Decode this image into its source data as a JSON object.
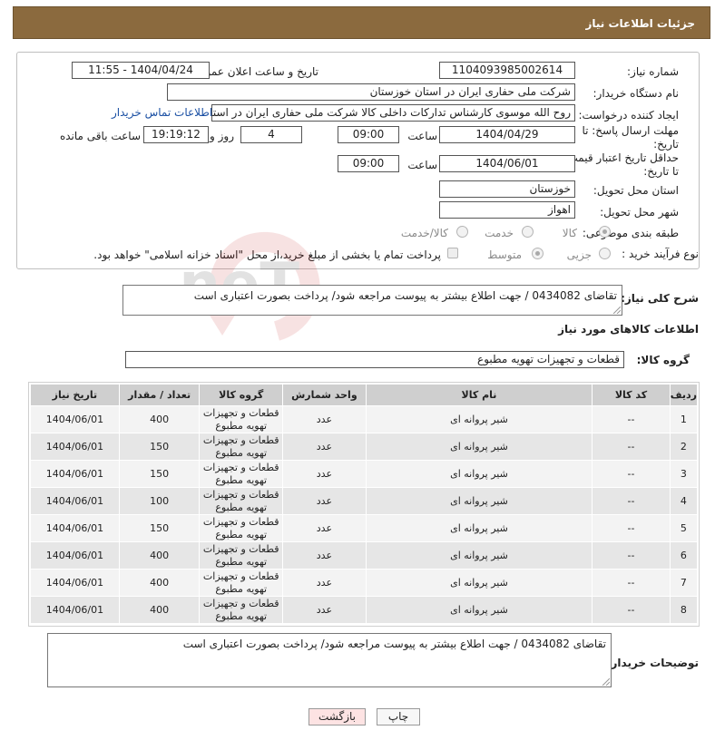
{
  "header": {
    "title": "جزئیات اطلاعات نیاز"
  },
  "form": {
    "need_number_label": "شماره نیاز:",
    "need_number": "1104093985002614",
    "announce_label": "تاریخ و ساعت اعلان عمومی:",
    "announce_value": "1404/04/24 - 11:55",
    "buyer_org_label": "نام دستگاه خریدار:",
    "buyer_org": "شرکت ملی حفاری ایران در استان خوزستان",
    "creator_label": "ایجاد کننده درخواست:",
    "creator": "روح الله موسوی کارشناس تدارکات داخلی کالا شرکت ملی حفاری ایران در استان خوزستان",
    "contact_link": "اطلاعات تماس خریدار",
    "reply_deadline_label_1": "مهلت ارسال پاسخ: تا",
    "reply_deadline_label_2": "تاریخ:",
    "reply_date": "1404/04/29",
    "time_label": "ساعت",
    "reply_time": "09:00",
    "days_value": "4",
    "days_label": "روز و",
    "remaining_time": "19:19:12",
    "remaining_label": "ساعت باقی مانده",
    "price_deadline_label_1": "حداقل تاریخ اعتبار قیمت:",
    "price_deadline_label_2": "تا تاریخ:",
    "price_date": "1404/06/01",
    "price_time": "09:00",
    "province_label": "استان محل تحویل:",
    "province": "خوزستان",
    "city_label": "شهر محل تحویل:",
    "city": "اهواز",
    "category_label": "طبقه بندی موضوعی:",
    "category_options": [
      "کالا",
      "خدمت",
      "کالا/خدمت"
    ],
    "process_label": "نوع فرآیند خرید :",
    "process_options": [
      "جزیی",
      "متوسط"
    ],
    "payment_note": "پرداخت تمام یا بخشی از مبلغ خرید،از محل \"اسناد خزانه اسلامی\" خواهد بود."
  },
  "description": {
    "label": "شرح کلی نیاز:",
    "text": "تقاضای 0434082 / جهت اطلاع بیشتر به پیوست مراجعه شود/ پرداخت بصورت اعتباری است"
  },
  "goods_section": {
    "title": "اطلاعات کالاهای مورد نیاز",
    "group_label": "گروه کالا:",
    "group_value": "قطعات و تجهیزات تهویه مطبوع"
  },
  "table": {
    "headers": [
      "ردیف",
      "کد کالا",
      "نام کالا",
      "واحد شمارش",
      "گروه کالا",
      "تعداد / مقدار",
      "تاریخ نیاز"
    ],
    "rows": [
      {
        "idx": "1",
        "code": "--",
        "name": "شیر پروانه ای",
        "unit": "عدد",
        "group_1": "قطعات و تجهیزات",
        "group_2": "تهویه مطبوع",
        "qty": "400",
        "date": "1404/06/01"
      },
      {
        "idx": "2",
        "code": "--",
        "name": "شیر پروانه ای",
        "unit": "عدد",
        "group_1": "قطعات و تجهیزات",
        "group_2": "تهویه مطبوع",
        "qty": "150",
        "date": "1404/06/01"
      },
      {
        "idx": "3",
        "code": "--",
        "name": "شیر پروانه ای",
        "unit": "عدد",
        "group_1": "قطعات و تجهیزات",
        "group_2": "تهویه مطبوع",
        "qty": "150",
        "date": "1404/06/01"
      },
      {
        "idx": "4",
        "code": "--",
        "name": "شیر پروانه ای",
        "unit": "عدد",
        "group_1": "قطعات و تجهیزات",
        "group_2": "تهویه مطبوع",
        "qty": "100",
        "date": "1404/06/01"
      },
      {
        "idx": "5",
        "code": "--",
        "name": "شیر پروانه ای",
        "unit": "عدد",
        "group_1": "قطعات و تجهیزات",
        "group_2": "تهویه مطبوع",
        "qty": "150",
        "date": "1404/06/01"
      },
      {
        "idx": "6",
        "code": "--",
        "name": "شیر پروانه ای",
        "unit": "عدد",
        "group_1": "قطعات و تجهیزات",
        "group_2": "تهویه مطبوع",
        "qty": "400",
        "date": "1404/06/01"
      },
      {
        "idx": "7",
        "code": "--",
        "name": "شیر پروانه ای",
        "unit": "عدد",
        "group_1": "قطعات و تجهیزات",
        "group_2": "تهویه مطبوع",
        "qty": "400",
        "date": "1404/06/01"
      },
      {
        "idx": "8",
        "code": "--",
        "name": "شیر پروانه ای",
        "unit": "عدد",
        "group_1": "قطعات و تجهیزات",
        "group_2": "تهویه مطبوع",
        "qty": "400",
        "date": "1404/06/01"
      }
    ]
  },
  "buyer_notes": {
    "label": "توضیحات خریدار:",
    "text": "تقاضای 0434082 / جهت اطلاع بیشتر به پیوست مراجعه شود/ پرداخت بصورت اعتباری است"
  },
  "buttons": {
    "print": "چاپ",
    "back": "بازگشت"
  },
  "watermark_text": "AriaTender.neT",
  "colors": {
    "header_bg": "#8b6a3e",
    "link": "#1a4fa3",
    "back_button_bg": "#fde3e3"
  }
}
